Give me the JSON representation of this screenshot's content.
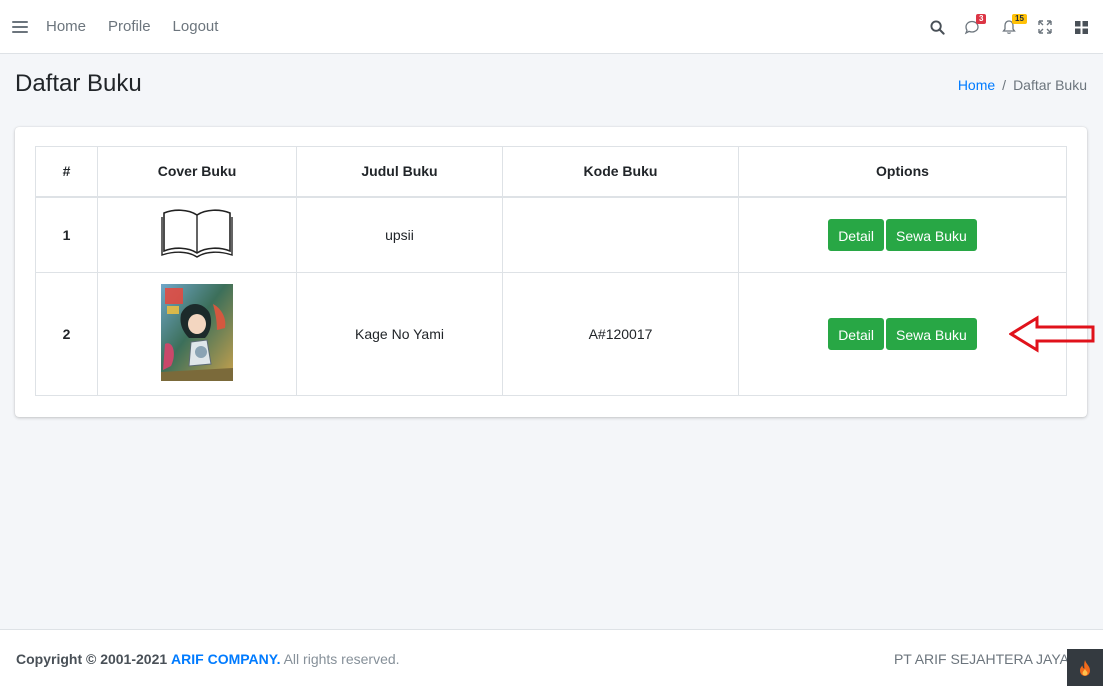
{
  "navbar": {
    "links": [
      "Home",
      "Profile",
      "Logout"
    ],
    "messages_badge": "3",
    "notifications_badge": "15",
    "icons": [
      "search-icon",
      "comments-icon",
      "bell-icon",
      "expand-icon",
      "grid-icon"
    ]
  },
  "header": {
    "title": "Daftar Buku",
    "breadcrumb": {
      "home": "Home",
      "separator": "/",
      "current": "Daftar Buku"
    }
  },
  "table": {
    "columns": [
      "#",
      "Cover Buku",
      "Judul Buku",
      "Kode Buku",
      "Options"
    ],
    "rows": [
      {
        "num": "1",
        "title": "upsii",
        "code": "",
        "cover": "open-book-icon"
      },
      {
        "num": "2",
        "title": "Kage No Yami",
        "code": "A#120017",
        "cover": "manga-cover"
      }
    ],
    "detail_label": "Detail",
    "rent_label": "Sewa Buku"
  },
  "footer": {
    "copyright_prefix": "Copyright © 2001-2021",
    "brand": "ARIF COMPANY.",
    "suffix": "All rights reserved.",
    "right_text": "PT ARIF SEJAHTERA JAYA"
  },
  "colors": {
    "primary": "#007bff",
    "success": "#28a745",
    "danger": "#dc3545",
    "warning": "#ffc107",
    "annotation_arrow": "#e0121b"
  }
}
